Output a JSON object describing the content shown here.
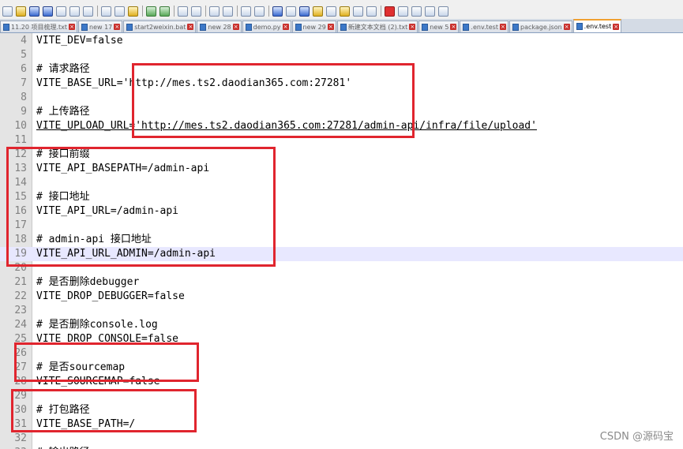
{
  "tabs": [
    {
      "label": "11.20 项目梳理.txt",
      "active": false
    },
    {
      "label": "new 17",
      "active": false
    },
    {
      "label": "start2weixin.bat",
      "active": false
    },
    {
      "label": "new 28",
      "active": false
    },
    {
      "label": "demo.py",
      "active": false
    },
    {
      "label": "new 29",
      "active": false
    },
    {
      "label": "新建文本文档 (2).txt",
      "active": false
    },
    {
      "label": "new 5",
      "active": false
    },
    {
      "label": ".env.test",
      "active": false
    },
    {
      "label": "package.json",
      "active": false
    },
    {
      "label": ".env.test",
      "active": true
    }
  ],
  "editor": {
    "current_line": 19,
    "lines": [
      {
        "n": "4",
        "text": "VITE_DEV=false"
      },
      {
        "n": "5",
        "text": ""
      },
      {
        "n": "6",
        "text": "# 请求路径"
      },
      {
        "n": "7",
        "text": "VITE_BASE_URL='http://mes.ts2.daodian365.com:27281'"
      },
      {
        "n": "8",
        "text": ""
      },
      {
        "n": "9",
        "text": "# 上传路径"
      },
      {
        "n": "10",
        "text": "VITE_UPLOAD_URL='http://mes.ts2.daodian365.com:27281/admin-api/infra/file/upload'"
      },
      {
        "n": "11",
        "text": ""
      },
      {
        "n": "12",
        "text": "# 接口前缀"
      },
      {
        "n": "13",
        "text": "VITE_API_BASEPATH=/admin-api"
      },
      {
        "n": "14",
        "text": ""
      },
      {
        "n": "15",
        "text": "# 接口地址"
      },
      {
        "n": "16",
        "text": "VITE_API_URL=/admin-api"
      },
      {
        "n": "17",
        "text": ""
      },
      {
        "n": "18",
        "text": "# admin-api 接口地址"
      },
      {
        "n": "19",
        "text": "VITE_API_URL_ADMIN=/admin-api"
      },
      {
        "n": "20",
        "text": ""
      },
      {
        "n": "21",
        "text": "# 是否删除debugger"
      },
      {
        "n": "22",
        "text": "VITE_DROP_DEBUGGER=false"
      },
      {
        "n": "23",
        "text": ""
      },
      {
        "n": "24",
        "text": "# 是否删除console.log"
      },
      {
        "n": "25",
        "text": "VITE_DROP_CONSOLE=false"
      },
      {
        "n": "26",
        "text": ""
      },
      {
        "n": "27",
        "text": "# 是否sourcemap"
      },
      {
        "n": "28",
        "text": "VITE_SOURCEMAP=false"
      },
      {
        "n": "29",
        "text": ""
      },
      {
        "n": "30",
        "text": "# 打包路径"
      },
      {
        "n": "31",
        "text": "VITE_BASE_PATH=/"
      },
      {
        "n": "32",
        "text": ""
      },
      {
        "n": "33",
        "text": "# 输出路径"
      }
    ]
  },
  "annotations_color": "#e0252e",
  "watermark": "CSDN @源码宝"
}
